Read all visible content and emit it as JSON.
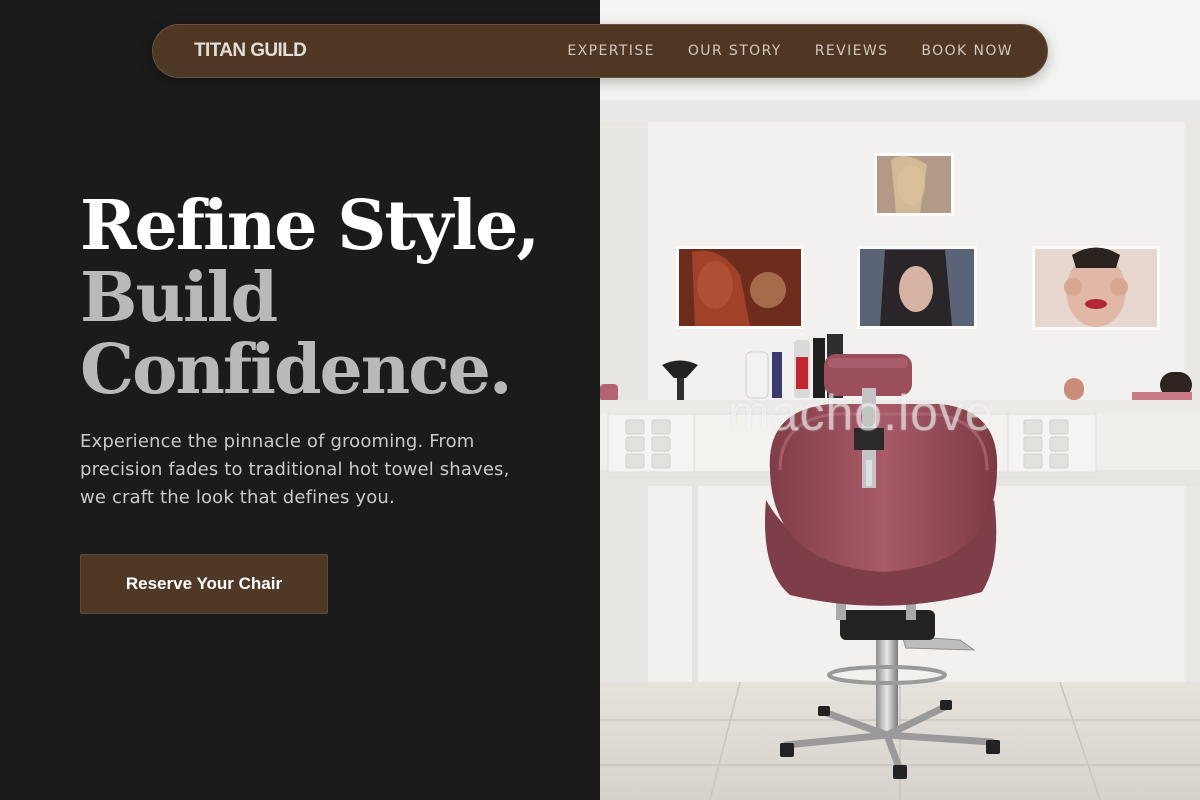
{
  "brand": {
    "name": "TITAN GUILD"
  },
  "nav": {
    "links": [
      "EXPERTISE",
      "OUR STORY",
      "REVIEWS",
      "BOOK NOW"
    ]
  },
  "hero": {
    "headline": [
      "Refine Style,",
      "Build",
      "Confidence."
    ],
    "subtext": "Experience the pinnacle of grooming. From precision fades to traditional hot towel shaves, we craft the look that defines you.",
    "cta_label": "Reserve Your Chair"
  },
  "photo": {
    "watermark": "macho.love"
  },
  "colors": {
    "background": "#1b1b1b",
    "nav_background": "#4e3723",
    "accent_brown": "#4f3826",
    "headline_white": "#ffffff",
    "headline_grey": "#b9b9b9",
    "chair_red": "#9a4f5c"
  }
}
